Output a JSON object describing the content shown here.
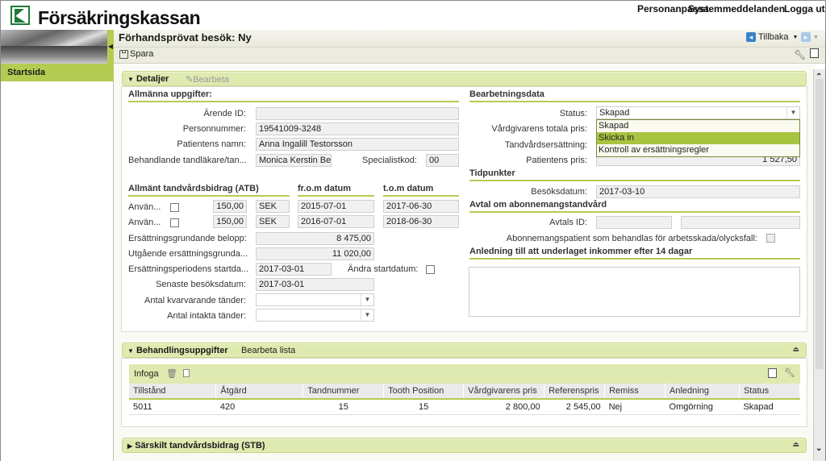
{
  "header": {
    "logo_text": "Försäkringskassan",
    "links": [
      "Personanpassa",
      "Systemmeddelanden",
      "Logga ut"
    ]
  },
  "sidebar": {
    "items": [
      {
        "label": "Startsida",
        "active": true
      }
    ]
  },
  "page": {
    "title": "Förhandsprövat besök: Ny",
    "back_label": "Tillbaka",
    "save_label": "Spara"
  },
  "detaljer": {
    "title": "Detaljer",
    "edit_label": "Bearbeta",
    "allmanna": {
      "title": "Allmänna uppgifter:",
      "arende_id_label": "Ärende ID:",
      "arende_id": "",
      "personnummer_label": "Personnummer:",
      "personnummer": "19541009-3248",
      "patient_namn_label": "Patientens namn:",
      "patient_namn": "Anna Ingalill Testorsson",
      "behandlare_label": "Behandlande tandläkare/tan...",
      "behandlare": "Monica Kerstin Ber",
      "specialistkod_label": "Specialistkod:",
      "specialistkod": "00"
    },
    "atb": {
      "title": "Allmänt tandvårdsbidrag (ATB)",
      "from_header": "fr.o.m datum",
      "tom_header": "t.o.m datum",
      "rows": [
        {
          "label": "Använ...",
          "checked": false,
          "amount": "150,00",
          "currency": "SEK",
          "from": "2015-07-01",
          "to": "2017-06-30"
        },
        {
          "label": "Använ...",
          "checked": false,
          "amount": "150,00",
          "currency": "SEK",
          "from": "2016-07-01",
          "to": "2018-06-30"
        }
      ],
      "ersgrund_label": "Ersättningsgrundande belopp:",
      "ersgrund": "8 475,00",
      "utgaende_label": "Utgående ersättningsgrunda...",
      "utgaende": "11 020,00",
      "startdatum_label": "Ersättningsperiodens startda...",
      "startdatum": "2017-03-01",
      "andra_startdatum_label": "Ändra startdatum:",
      "senaste_label": "Senaste besöksdatum:",
      "senaste": "2017-03-01",
      "kvarvarande_label": "Antal kvarvarande tänder:",
      "kvarvarande": "",
      "intakta_label": "Antal intakta tänder:",
      "intakta": ""
    },
    "bearbetning": {
      "title": "Bearbetningsdata",
      "status_label": "Status:",
      "status_value": "Skapad",
      "status_options": [
        "Skapad",
        "Skicka in",
        "Kontroll av ersättningsregler"
      ],
      "status_highlighted": "Skicka in",
      "total_pris_label": "Vårdgivarens totala pris:",
      "ersattning_label": "Tandvårdsersättning:",
      "patient_pris_label": "Patientens pris:",
      "patient_pris": "1 527,50"
    },
    "tidpunkter": {
      "title": "Tidpunkter",
      "besoksdatum_label": "Besöksdatum:",
      "besoksdatum": "2017-03-10"
    },
    "avtal": {
      "title": "Avtal om abonnemangstandvård",
      "avtals_id_label": "Avtals ID:",
      "avtals_id": "",
      "avtals_id2": "",
      "abonnemang_label": "Abonnemangspatient som behandlas för arbetsskada/olycksfall:"
    },
    "anledning": {
      "title": "Anledning till att underlaget inkommer efter 14 dagar",
      "text": ""
    }
  },
  "behandling": {
    "title": "Behandlingsuppgifter",
    "edit_list_label": "Bearbeta lista",
    "insert_label": "Infoga",
    "columns": [
      "Tillstånd",
      "Åtgärd",
      "Tandnummer",
      "Tooth Position",
      "Vårdgivarens pris",
      "Referenspris",
      "Remiss",
      "Anledning",
      "Status"
    ],
    "rows": [
      [
        "5011",
        "420",
        "15",
        "15",
        "2 800,00",
        "2 545,00",
        "Nej",
        "Omgörning",
        "Skapad"
      ]
    ]
  },
  "stb": {
    "title": "Särskilt tandvårdsbidrag (STB)"
  },
  "colors": {
    "accent_green": "#b4cc52",
    "panel_header": "#dfeab0",
    "brand_green": "#1f7a3a"
  }
}
